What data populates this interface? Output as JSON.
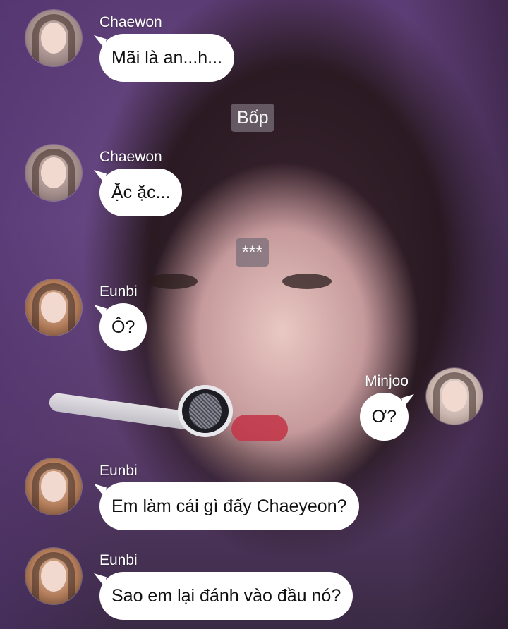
{
  "messages": [
    {
      "sender": "Chaewon",
      "text": "Mãi là an...h...",
      "side": "left",
      "avatar_icon": "chaewon-avatar"
    },
    {
      "system": "Bốp"
    },
    {
      "sender": "Chaewon",
      "text": "Ặc ặc...",
      "side": "left",
      "avatar_icon": "chaewon-avatar"
    },
    {
      "system": "***"
    },
    {
      "sender": "Eunbi",
      "text": "Ô?",
      "side": "left",
      "avatar_icon": "eunbi-avatar"
    },
    {
      "sender": "Minjoo",
      "text": "Ơ?",
      "side": "right",
      "avatar_icon": "minjoo-avatar"
    },
    {
      "sender": "Eunbi",
      "text": "Em làm cái gì đấy Chaeyeon?",
      "side": "left",
      "avatar_icon": "eunbi-avatar"
    },
    {
      "sender": "Eunbi",
      "text": "Sao em lại đánh vào đầu nó?",
      "side": "left",
      "avatar_icon": "eunbi-avatar"
    }
  ],
  "colors": {
    "bubble": "#ffffff",
    "system_badge": "#786e78",
    "name_text": "#ffffff"
  }
}
